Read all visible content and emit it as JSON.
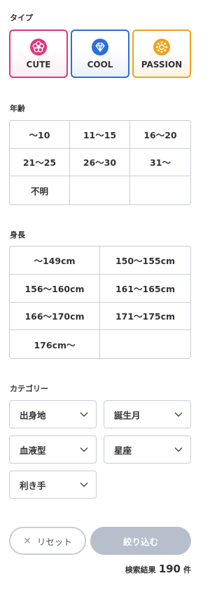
{
  "type_section": {
    "title": "タイプ",
    "items": [
      {
        "label": "CUTE",
        "icon": "flower-icon",
        "color": "#e0357f"
      },
      {
        "label": "COOL",
        "icon": "diamond-icon",
        "color": "#2a6fd8"
      },
      {
        "label": "PASSION",
        "icon": "sun-icon",
        "color": "#efa21c"
      }
    ]
  },
  "age_section": {
    "title": "年齢",
    "options": [
      "〜10",
      "11〜15",
      "16〜20",
      "21〜25",
      "26〜30",
      "31〜",
      "不明",
      "",
      ""
    ]
  },
  "height_section": {
    "title": "身長",
    "options": [
      "〜149cm",
      "150〜155cm",
      "156〜160cm",
      "161〜165cm",
      "166〜170cm",
      "171〜175cm",
      "176cm〜",
      ""
    ]
  },
  "category_section": {
    "title": "カテゴリー",
    "selects": [
      "出身地",
      "誕生月",
      "血液型",
      "星座",
      "利き手"
    ]
  },
  "actions": {
    "reset_icon": "×",
    "reset_label": "リセット",
    "submit_label": "絞り込む",
    "submit_color": "#b8bfcc"
  },
  "result": {
    "prefix": "検索結果",
    "count": "190",
    "suffix": "件"
  }
}
